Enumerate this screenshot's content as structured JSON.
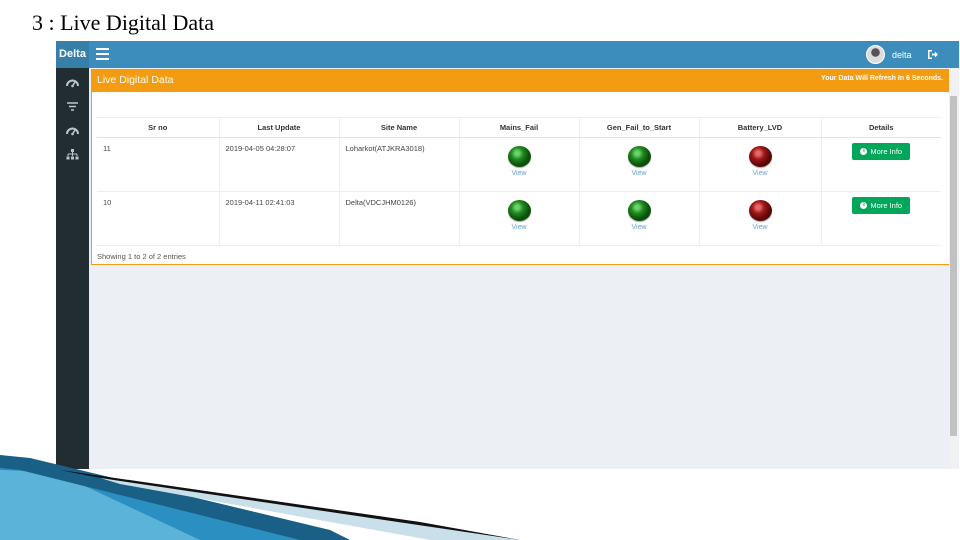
{
  "slide": {
    "title": "3 : Live Digital Data"
  },
  "app": {
    "brand": "Delta",
    "user_name": "delta",
    "colors": {
      "topbar": "#3c8dbc",
      "sidebar": "#222d32",
      "box_header": "#f39c12",
      "button": "#00a65a"
    }
  },
  "sidebar": {
    "items": [
      {
        "icon": "dashboard-icon"
      },
      {
        "icon": "filter-icon"
      },
      {
        "icon": "dashboard-icon"
      },
      {
        "icon": "sitemap-icon"
      }
    ]
  },
  "box": {
    "title": "Live Digital Data",
    "refresh_note": "Your Data Will Refresh In 6 Seconds."
  },
  "table": {
    "columns": [
      "Sr no",
      "Last Update",
      "Site Name",
      "Mains_Fail",
      "Gen_Fail_to_Start",
      "Battery_LVD",
      "Details"
    ],
    "rows": [
      {
        "sr_no": "11",
        "last_update": "2019-04-05 04:28:07",
        "site_name": "Loharkot(ATJKRA3018)",
        "mains_fail": {
          "status": "green",
          "link": "View"
        },
        "gen_fail": {
          "status": "green",
          "link": "View"
        },
        "battery_lvd": {
          "status": "red",
          "link": "View"
        },
        "details_label": "More Info"
      },
      {
        "sr_no": "10",
        "last_update": "2019-04-11 02:41:03",
        "site_name": "Delta(VDCJHM0126)",
        "mains_fail": {
          "status": "green",
          "link": "View"
        },
        "gen_fail": {
          "status": "green",
          "link": "View"
        },
        "battery_lvd": {
          "status": "red",
          "link": "View"
        },
        "details_label": "More Info"
      }
    ],
    "footer": "Showing 1 to 2 of 2 entries"
  }
}
